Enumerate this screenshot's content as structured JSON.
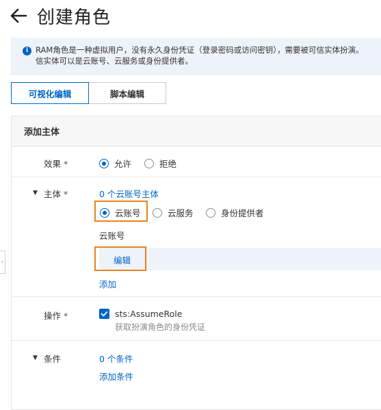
{
  "page": {
    "title": "创建角色"
  },
  "notice": {
    "line1": "RAM角色是一种虚拟用户，没有永久身份凭证（登录密码或访问密钥），需要被可信实体扮演。",
    "line2": "信实体可以是云账号、云服务或身份提供者。"
  },
  "tabs": [
    {
      "label": "可视化编辑",
      "active": true
    },
    {
      "label": "脚本编辑",
      "active": false
    }
  ],
  "panel": {
    "title": "添加主体",
    "effect": {
      "label": "效果",
      "required": "*",
      "options": [
        {
          "label": "允许",
          "selected": true
        },
        {
          "label": "拒绝",
          "selected": false
        }
      ]
    },
    "principal": {
      "label": "主体",
      "required": "*",
      "count_link": "0 个云账号主体",
      "options": [
        {
          "label": "云账号",
          "selected": true
        },
        {
          "label": "云服务",
          "selected": false
        },
        {
          "label": "身份提供者",
          "selected": false
        }
      ],
      "section_label": "云账号",
      "edit_label": "编辑",
      "add_label": "添加"
    },
    "action": {
      "label": "操作",
      "required": "*",
      "value": "sts:AssumeRole",
      "description": "获取扮演角色的身份凭证",
      "checked": true
    },
    "condition": {
      "label": "条件",
      "count_link": "0 个条件",
      "add_label": "添加条件"
    }
  },
  "colors": {
    "accent": "#0064c8",
    "highlight": "#e8821e",
    "notice_bg": "#eef3fa"
  }
}
